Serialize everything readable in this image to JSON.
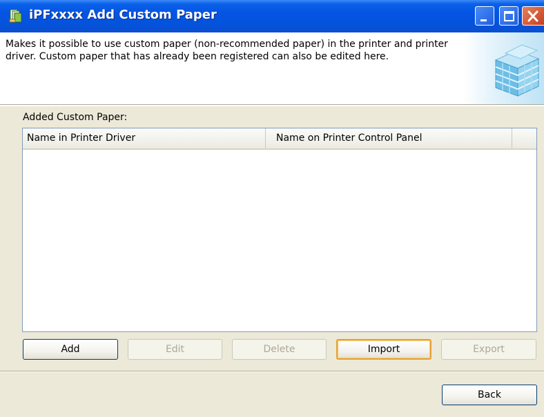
{
  "window": {
    "title": "iPFxxxx  Add Custom Paper"
  },
  "header": {
    "description": "Makes it possible to use custom paper (non-recommended paper) in the printer and printer driver. Custom paper that has already been registered can also be edited here."
  },
  "main": {
    "list_label": "Added Custom Paper:",
    "columns": [
      "Name in Printer Driver",
      "Name on Printer Control Panel",
      ""
    ],
    "rows": []
  },
  "buttons": {
    "add": "Add",
    "edit": "Edit",
    "delete": "Delete",
    "import": "Import",
    "export": "Export",
    "back": "Back"
  },
  "colors": {
    "titlebar": "#0554e3",
    "face": "#ece9d8",
    "close_button": "#c4401f",
    "focus_ring": "#e5a23a"
  },
  "icons": [
    "printer-icon",
    "minimize-icon",
    "maximize-icon",
    "close-icon",
    "paper-stack-art"
  ]
}
